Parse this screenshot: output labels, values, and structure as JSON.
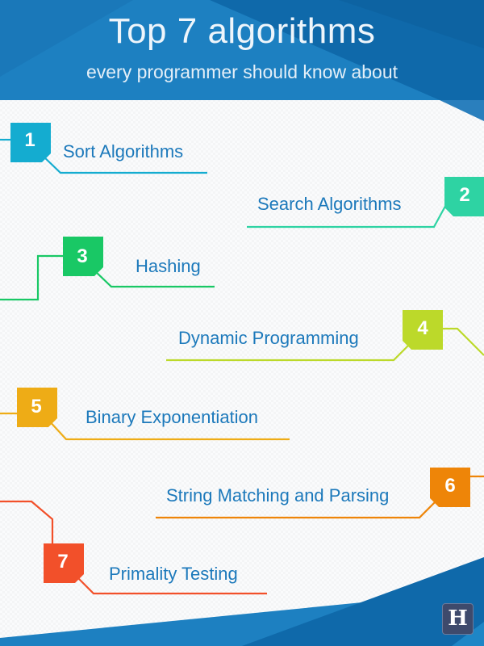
{
  "header": {
    "title": "Top 7 algorithms",
    "subtitle": "every programmer should know about"
  },
  "colors": {
    "header_blue": "#1d7fc0",
    "header_dark": "#0f68a8",
    "label_text": "#1c79bb"
  },
  "items": [
    {
      "number": "1",
      "label": "Sort Algorithms",
      "color": "#14acd0"
    },
    {
      "number": "2",
      "label": "Search Algorithms",
      "color": "#2ed3a3"
    },
    {
      "number": "3",
      "label": "Hashing",
      "color": "#19c865"
    },
    {
      "number": "4",
      "label": "Dynamic Programming",
      "color": "#bcd92a"
    },
    {
      "number": "5",
      "label": "Binary Exponentiation",
      "color": "#eeac16"
    },
    {
      "number": "6",
      "label": "String Matching and Parsing",
      "color": "#ee8508"
    },
    {
      "number": "7",
      "label": "Primality Testing",
      "color": "#f2502a"
    }
  ],
  "logo": {
    "letter": "H"
  }
}
